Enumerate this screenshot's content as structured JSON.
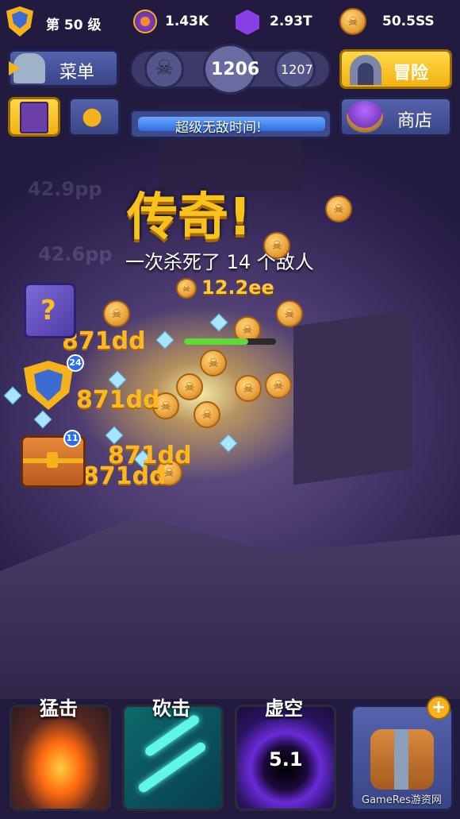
{
  "hud": {
    "level": "第 50 级",
    "orb_count": "1.43K",
    "gem_count": "2.93T",
    "coin_count": "50.5SS",
    "menu_label": "菜单",
    "stage_current": "1206",
    "stage_next": "1207",
    "adventure_label": "冒险",
    "shop_label": "商店",
    "super_banner": "超级无敌时间!"
  },
  "battle": {
    "headline": "传奇!",
    "kill_text": "一次杀死了 14 个敌人",
    "coin_reward": "12.2ee",
    "faded_labels": [
      "42.9pp",
      "42.6pp"
    ],
    "damage_numbers": [
      "871dd",
      "871dd",
      "871dd",
      "871dd"
    ],
    "shield_badge": "24",
    "chest_badge": "11",
    "enemy_health_fraction": 0.7
  },
  "skills": [
    {
      "label": "猛击"
    },
    {
      "label": "砍击"
    },
    {
      "label": "虚空",
      "cooldown": "5.1"
    }
  ],
  "watermark": "GameRes游资网",
  "colors": {
    "accent_yellow": "#f7c21c",
    "panel_blue": "#3f4a8c",
    "damage_orange": "#ffb820"
  }
}
